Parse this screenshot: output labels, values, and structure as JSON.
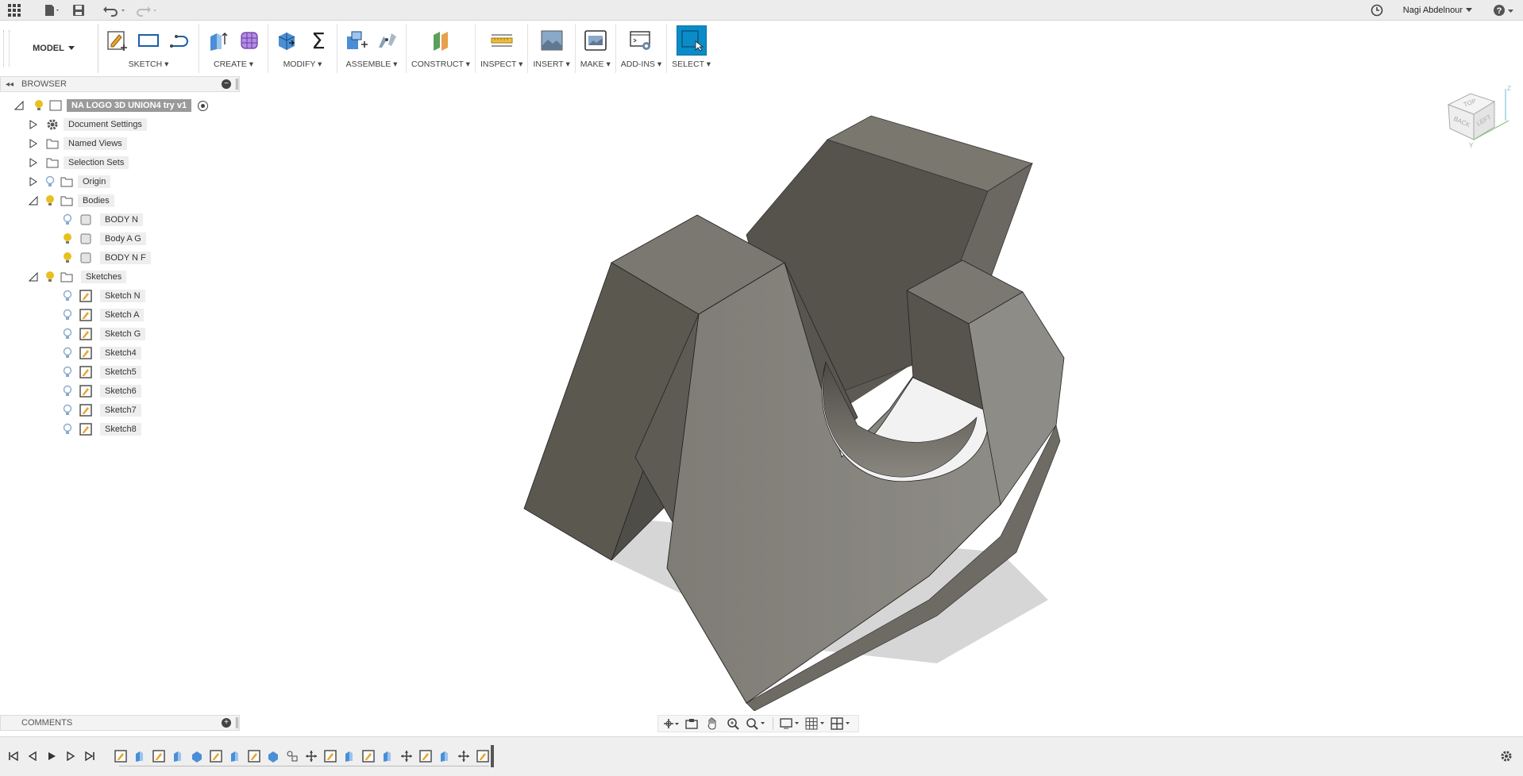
{
  "user": {
    "name": "Nagi Abdelnour"
  },
  "toolbar": {
    "workspace": "MODEL",
    "groups": {
      "sketch": "SKETCH",
      "create": "CREATE",
      "modify": "MODIFY",
      "assemble": "ASSEMBLE",
      "construct": "CONSTRUCT",
      "inspect": "INSPECT",
      "insert": "INSERT",
      "make": "MAKE",
      "addins": "ADD-INS",
      "select": "SELECT"
    }
  },
  "browser": {
    "title": "BROWSER",
    "root": "NA LOGO 3D UNION4 try v1",
    "items": {
      "document_settings": "Document Settings",
      "named_views": "Named Views",
      "selection_sets": "Selection Sets",
      "origin": "Origin",
      "bodies": "Bodies",
      "body_n": "BODY N",
      "body_ag": "Body A G",
      "body_nf": "BODY N F",
      "sketches": "Sketches",
      "sketch_n": "Sketch N",
      "sketch_a": "Sketch A",
      "sketch_g": "Sketch G",
      "sketch4": "Sketch4",
      "sketch5": "Sketch5",
      "sketch6": "Sketch6",
      "sketch7": "Sketch7",
      "sketch8": "Sketch8"
    }
  },
  "viewcube": {
    "top": "TOP",
    "back": "BACK",
    "left": "LEFT"
  },
  "comments": {
    "title": "COMMENTS"
  },
  "icons": {
    "apps": "grid-icon",
    "file": "file-icon",
    "save": "save-icon",
    "undo": "undo-icon",
    "redo": "redo-icon",
    "history": "clock-icon",
    "help": "help-icon",
    "settings": "gear-icon"
  },
  "colors": {
    "select_accent": "#0a8cc8",
    "body_dark": "#5b5850",
    "body_light": "#8a8882",
    "bulb_on": "#e8c020",
    "bulb_off": "#88aacc"
  }
}
